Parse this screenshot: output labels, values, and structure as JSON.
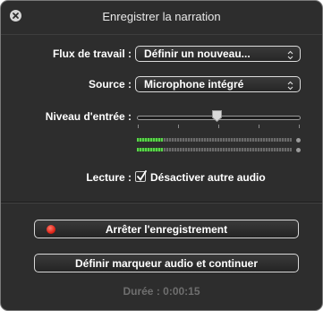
{
  "window": {
    "title": "Enregistrer la narration"
  },
  "workflow": {
    "label": "Flux de travail :",
    "value": "Définir un nouveau..."
  },
  "source": {
    "label": "Source :",
    "value": "Microphone intégré"
  },
  "input_level": {
    "label": "Niveau d'entrée :",
    "level": 0.55,
    "meter_left": 0.17,
    "meter_right": 0.17
  },
  "playback": {
    "label": "Lecture :",
    "checkbox_label": "Désactiver autre audio",
    "checked": true
  },
  "buttons": {
    "stop_recording": "Arrêter l'enregistrement",
    "set_marker": "Définir marqueur audio et continuer"
  },
  "duration": {
    "text": "Durée : 0:00:15"
  }
}
